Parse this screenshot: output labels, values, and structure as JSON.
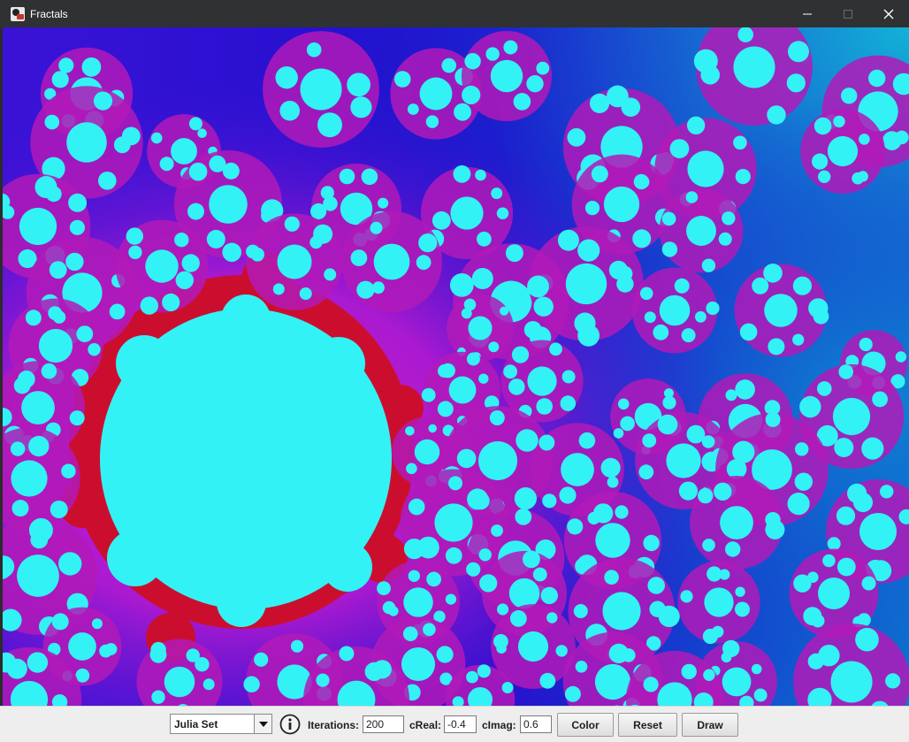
{
  "window": {
    "title": "Fractals",
    "app_icon": "app-logo-icon",
    "controls": [
      "minimize-icon",
      "maximize-icon",
      "close-icon"
    ]
  },
  "canvas": {
    "description_icon": "fractal-image",
    "colors": {
      "background_left": "#1a10d8",
      "background_right": "#0a7fd0",
      "glow": "#c21fc8",
      "set_fill": "#33f2f5",
      "border": "#cc0e2e",
      "filament": "#b21ab8"
    }
  },
  "controls": {
    "fractal_type": {
      "selected": "Julia Set",
      "icon": "chevron-down-icon"
    },
    "info_icon": "info-icon",
    "iterations": {
      "label": "Iterations:",
      "value": "200"
    },
    "c_real": {
      "label": "cReal:",
      "value": "-0.4"
    },
    "c_imag": {
      "label": "cImag:",
      "value": "0.6"
    },
    "buttons": {
      "color": "Color",
      "reset": "Reset",
      "draw": "Draw"
    }
  }
}
